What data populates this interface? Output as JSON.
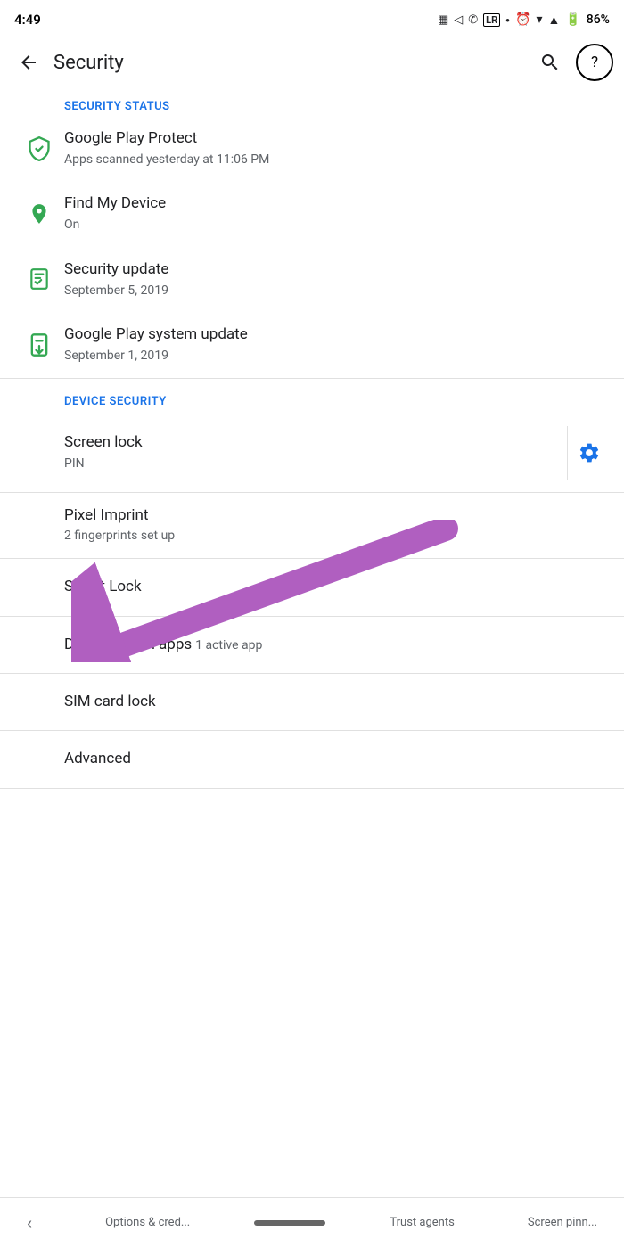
{
  "statusBar": {
    "time": "4:49",
    "battery": "86%",
    "icons": [
      "sms-icon",
      "navigation-icon",
      "whatsapp-icon",
      "lr-icon",
      "dot-icon",
      "alarm-icon",
      "wifi-icon",
      "signal-icon",
      "battery-icon"
    ]
  },
  "toolbar": {
    "title": "Security",
    "back_label": "←",
    "search_label": "🔍",
    "help_label": "?"
  },
  "securityStatus": {
    "sectionLabel": "SECURITY STATUS",
    "items": [
      {
        "title": "Google Play Protect",
        "subtitle": "Apps scanned yesterday at 11:06 PM",
        "icon": "shield-check-icon"
      },
      {
        "title": "Find My Device",
        "subtitle": "On",
        "icon": "location-pin-icon"
      },
      {
        "title": "Security update",
        "subtitle": "September 5, 2019",
        "icon": "security-checklist-icon"
      },
      {
        "title": "Google Play system update",
        "subtitle": "September 1, 2019",
        "icon": "system-update-icon"
      }
    ]
  },
  "deviceSecurity": {
    "sectionLabel": "DEVICE SECURITY",
    "items": [
      {
        "title": "Screen lock",
        "subtitle": "PIN",
        "hasGear": true
      },
      {
        "title": "Pixel Imprint",
        "subtitle": "2 fingerprints set up",
        "hasGear": false
      },
      {
        "title": "Smart Lock",
        "subtitle": "",
        "hasGear": false
      }
    ]
  },
  "otherItems": [
    {
      "title": "Device admin apps",
      "subtitle": "1 active app"
    },
    {
      "title": "SIM card lock",
      "subtitle": ""
    },
    {
      "title": "Advanced",
      "subtitle": ""
    }
  ],
  "bottomNav": {
    "options": "Options & cred...",
    "trustAgents": "Trust agents",
    "screenPinn": "Screen pinn..."
  },
  "arrow": {
    "color": "#b05fc0"
  }
}
